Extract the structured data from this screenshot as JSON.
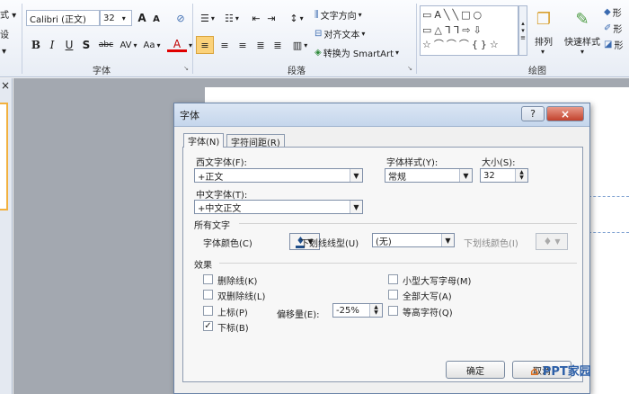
{
  "ribbon": {
    "left_cut": [
      "式 ▾",
      "设",
      "▾"
    ],
    "font_name": "Calibri (正文)",
    "font_size": "32",
    "group_font_label": "字体",
    "group_paragraph_label": "段落",
    "group_drawing_label": "绘图",
    "text_direction": "文字方向",
    "align_text": "对齐文本",
    "convert_smartart": "转换为 SmartArt",
    "arrange": "排列",
    "quick_styles": "快速样式",
    "shape_fill": "形",
    "shape_outline": "形",
    "shape_effects": "形",
    "grow_font": "A",
    "shrink_font": "A",
    "bold": "B",
    "italic": "I",
    "underline": "U",
    "shadow": "S",
    "strike": "abc",
    "spacing": "AV",
    "case": "Aa",
    "font_color": "A"
  },
  "left_pane": {
    "close": "×"
  },
  "dialog": {
    "title": "字体",
    "help": "?",
    "close": "×",
    "tabs": [
      "字体(N)",
      "字符间距(R)"
    ],
    "latin_font_label": "西文字体(F):",
    "latin_font_value": "+正文",
    "style_label": "字体样式(Y):",
    "style_value": "常规",
    "size_label": "大小(S):",
    "size_value": "32",
    "asian_font_label": "中文字体(T):",
    "asian_font_value": "+中文正文",
    "all_text_label": "所有文字",
    "font_color_label": "字体颜色(C)",
    "underline_style_label": "下划线线型(U)",
    "underline_style_value": "(无)",
    "underline_color_label": "下划线颜色(I)",
    "effects_label": "效果",
    "strike": "删除线(K)",
    "double_strike": "双删除线(L)",
    "superscript": "上标(P)",
    "subscript": "下标(B)",
    "offset_label": "偏移量(E):",
    "offset_value": "-25%",
    "small_caps": "小型大写字母(M)",
    "all_caps": "全部大写(A)",
    "equalize": "等高字符(Q)",
    "subscript_checked": "✓",
    "ok": "确定",
    "cancel": "取消"
  },
  "watermark": "PPT家园"
}
